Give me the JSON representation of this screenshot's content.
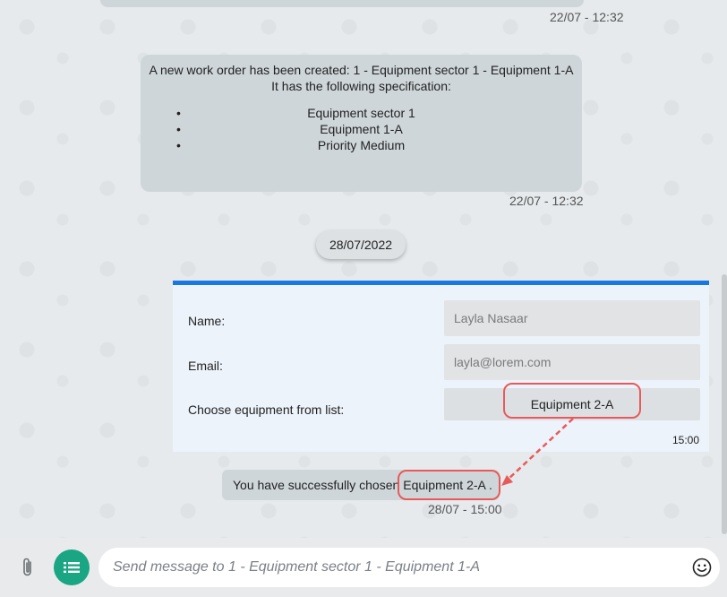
{
  "messages": [
    {
      "type": "partial",
      "timestamp": "22/07 - 12:32"
    },
    {
      "type": "work_order",
      "line1": "A new work order has been created: 1 -  Equipment sector 1 - Equipment 1-A",
      "line2": "It has the following specification:",
      "items": [
        "Equipment sector 1",
        "Equipment 1-A",
        "Priority Medium"
      ],
      "timestamp": "22/07 - 12:32"
    }
  ],
  "date_separator": "28/07/2022",
  "form": {
    "accent_color": "#1877e3",
    "name_label": "Name:",
    "name_value": "Layla Nasaar",
    "email_label": "Email:",
    "email_value": "layla@lorem.com",
    "equipment_label": "Choose equipment from list:",
    "equipment_value": "Equipment 2-A",
    "timestamp": "15:00"
  },
  "confirmation": {
    "prefix": "You have successfully chosen",
    "value": "Equipment 2-A .",
    "timestamp": "28/07 - 15:00"
  },
  "annotation_color": "#e85a5a",
  "composer": {
    "placeholder": "Send message to 1 - Equipment sector 1 - Equipment 1-A",
    "attach_icon": "paperclip-icon",
    "menu_icon": "list-icon",
    "emoji_icon": "smiley-icon",
    "menu_color": "#1aa583"
  }
}
